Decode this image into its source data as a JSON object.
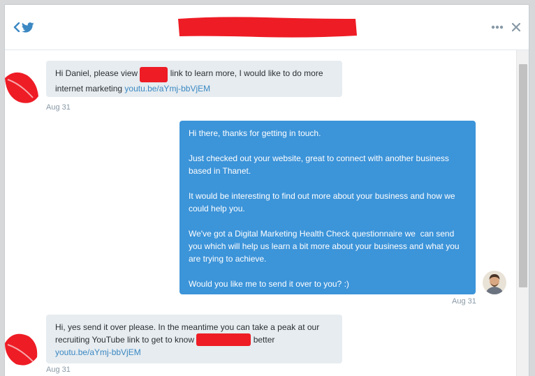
{
  "header": {
    "title": "",
    "back_label": "Back",
    "more_label": "More",
    "close_label": "Close"
  },
  "colors": {
    "accent_blue": "#3c94d9",
    "twitter_blue": "#1da1f2",
    "incoming_bubble": "#e6ecf0",
    "link": "#3b88c3",
    "redaction": "#ee1c25"
  },
  "icons": {
    "back": "chevron-left-icon",
    "twitter": "twitter-bird-icon",
    "more": "more-dots-icon",
    "close": "close-icon"
  },
  "messages": [
    {
      "direction": "incoming",
      "text_before": "Hi Daniel, please view",
      "text_after": "link to learn more, I would like to do more internet marketing ",
      "link": "youtu.be/aYmj-bbVjEM",
      "timestamp": "Aug 31"
    },
    {
      "direction": "outgoing",
      "text": "Hi there, thanks for getting in touch.\n\nJust checked out your website, great to connect with another business based in Thanet.\n\nIt would be interesting to find out more about your business and how we could help you.\n\nWe've got a Digital Marketing Health Check questionnaire we  can send you which will help us learn a bit more about your business and what you are trying to achieve.\n\nWould you like me to send it over to you? :)",
      "timestamp": "Aug 31"
    },
    {
      "direction": "incoming",
      "text_before": "Hi, yes send it over please. In the meantime you can take a peak at our recruiting YouTube link to get to know",
      "text_after": "better  ",
      "link": "youtu.be/aYmj-bbVjEM",
      "timestamp": "Aug 31"
    }
  ]
}
